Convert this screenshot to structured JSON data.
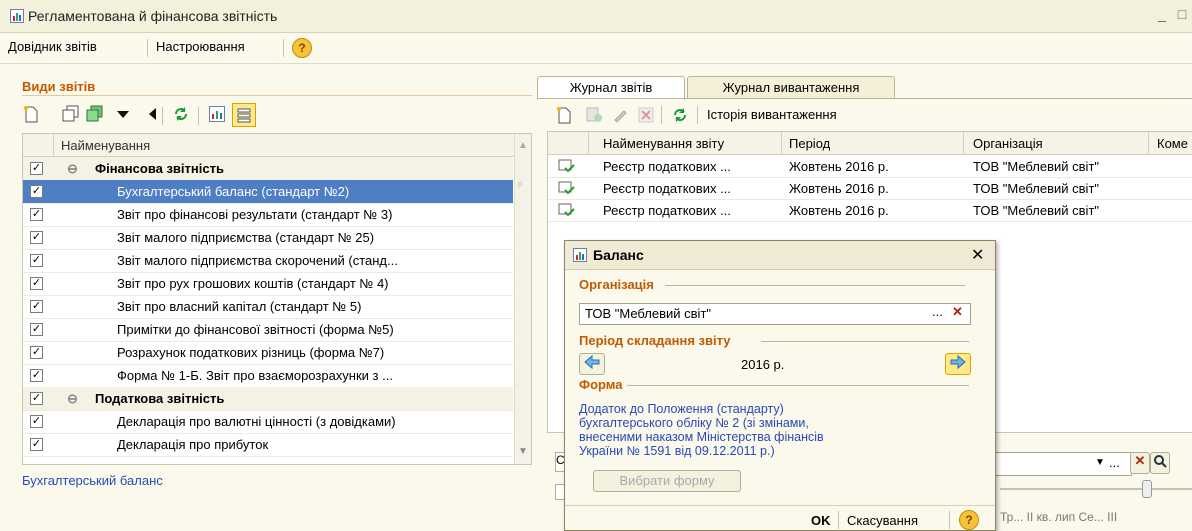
{
  "window": {
    "title": "Регламентована й фінансова звітність"
  },
  "menu": {
    "item1": "Довідник звітів",
    "item2": "Настроювання",
    "help": "?"
  },
  "left": {
    "section_title": "Види звітів",
    "column_header": "Найменування",
    "rows": [
      {
        "label": "Фінансова звітність",
        "group": true
      },
      {
        "label": "Бухгалтерський баланс (стандарт №2)"
      },
      {
        "label": "Звіт про фінансові результати (стандарт № 3)"
      },
      {
        "label": "Звіт малого підприємства (стандарт № 25)"
      },
      {
        "label": "Звіт малого підприємства скорочений (станд..."
      },
      {
        "label": "Звіт про рух грошових коштів (стандарт № 4)"
      },
      {
        "label": "Звіт про власний капітал (стандарт № 5)"
      },
      {
        "label": "Примітки до фінансової звітності (форма №5)"
      },
      {
        "label": "Розрахунок податкових різниць (форма №7)"
      },
      {
        "label": "Форма № 1-Б. Звіт про взаєморозрахунки з ..."
      },
      {
        "label": "Податкова звітність",
        "group": true
      },
      {
        "label": "Декларація про валютні цінності (з довідками)"
      },
      {
        "label": "Декларація про прибуток"
      }
    ],
    "footer_link": "Бухгалтерський баланс"
  },
  "right": {
    "tabs": [
      "Журнал звітів",
      "Журнал вивантаження"
    ],
    "toolbar_history": "Історія вивантаження",
    "columns": [
      "Найменування звіту",
      "Період",
      "Організація",
      "Коме"
    ],
    "rows": [
      [
        "Реєстр податкових ...",
        "Жовтень 2016 р.",
        "ТОВ \"Меблевий світ\""
      ],
      [
        "Реєстр податкових ...",
        "Жовтень 2016 р.",
        "ТОВ \"Меблевий світ\""
      ],
      [
        "Реєстр податкових ...",
        "Жовтень 2016 р.",
        "ТОВ \"Меблевий світ\""
      ]
    ],
    "filter_first_letter": "С",
    "bottom_letters": "Тр... II кв. лип Се... III"
  },
  "dialog": {
    "title": "Баланс",
    "org_label": "Організація",
    "org_value": "ТОВ \"Меблевий світ\"",
    "period_label": "Період складання звіту",
    "period_value": "2016 р.",
    "form_label": "Форма",
    "form_text": "Додаток до Положення (стандарту) бухгалтерського обліку № 2 (зі змінами, внесеними наказом Міністерства фінансів України № 1591 від 09.12.2011 р.)",
    "choose_button": "Вибрати форму",
    "ok_button": "OK",
    "cancel_button": "Скасування"
  },
  "colors": {
    "accent_orange": "#c25a00",
    "selection_blue": "#4e7fc4",
    "link_blue": "#2849b8"
  }
}
